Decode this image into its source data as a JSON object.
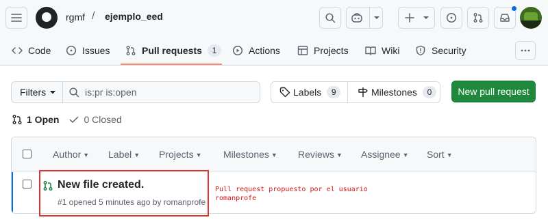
{
  "header": {
    "owner": "rgmf",
    "separator": "/",
    "repo": "ejemplo_eed"
  },
  "tabs": [
    {
      "label": "Code"
    },
    {
      "label": "Issues"
    },
    {
      "label": "Pull requests",
      "count": "1"
    },
    {
      "label": "Actions"
    },
    {
      "label": "Projects"
    },
    {
      "label": "Wiki"
    },
    {
      "label": "Security"
    }
  ],
  "filters": {
    "filters_label": "Filters",
    "search_value": "is:pr is:open",
    "labels_label": "Labels",
    "labels_count": "9",
    "milestones_label": "Milestones",
    "milestones_count": "0",
    "new_pr_label": "New pull request"
  },
  "state": {
    "open_label": "1 Open",
    "closed_label": "0 Closed"
  },
  "list_header": {
    "author": "Author",
    "label": "Label",
    "projects": "Projects",
    "milestones": "Milestones",
    "reviews": "Reviews",
    "assignee": "Assignee",
    "sort": "Sort"
  },
  "pull_requests": [
    {
      "title": "New file created.",
      "meta": "#1 opened 5 minutes ago by romanprofe"
    }
  ],
  "annotation": {
    "line1": "Pull request propuesto por el usuario",
    "line2": "romanprofe"
  },
  "colors": {
    "accent_green": "#1f883d",
    "tab_underline": "#fd8c73",
    "open_icon": "#1a7f37",
    "annotation_red": "#e0312f",
    "notification_dot": "#0969da"
  }
}
